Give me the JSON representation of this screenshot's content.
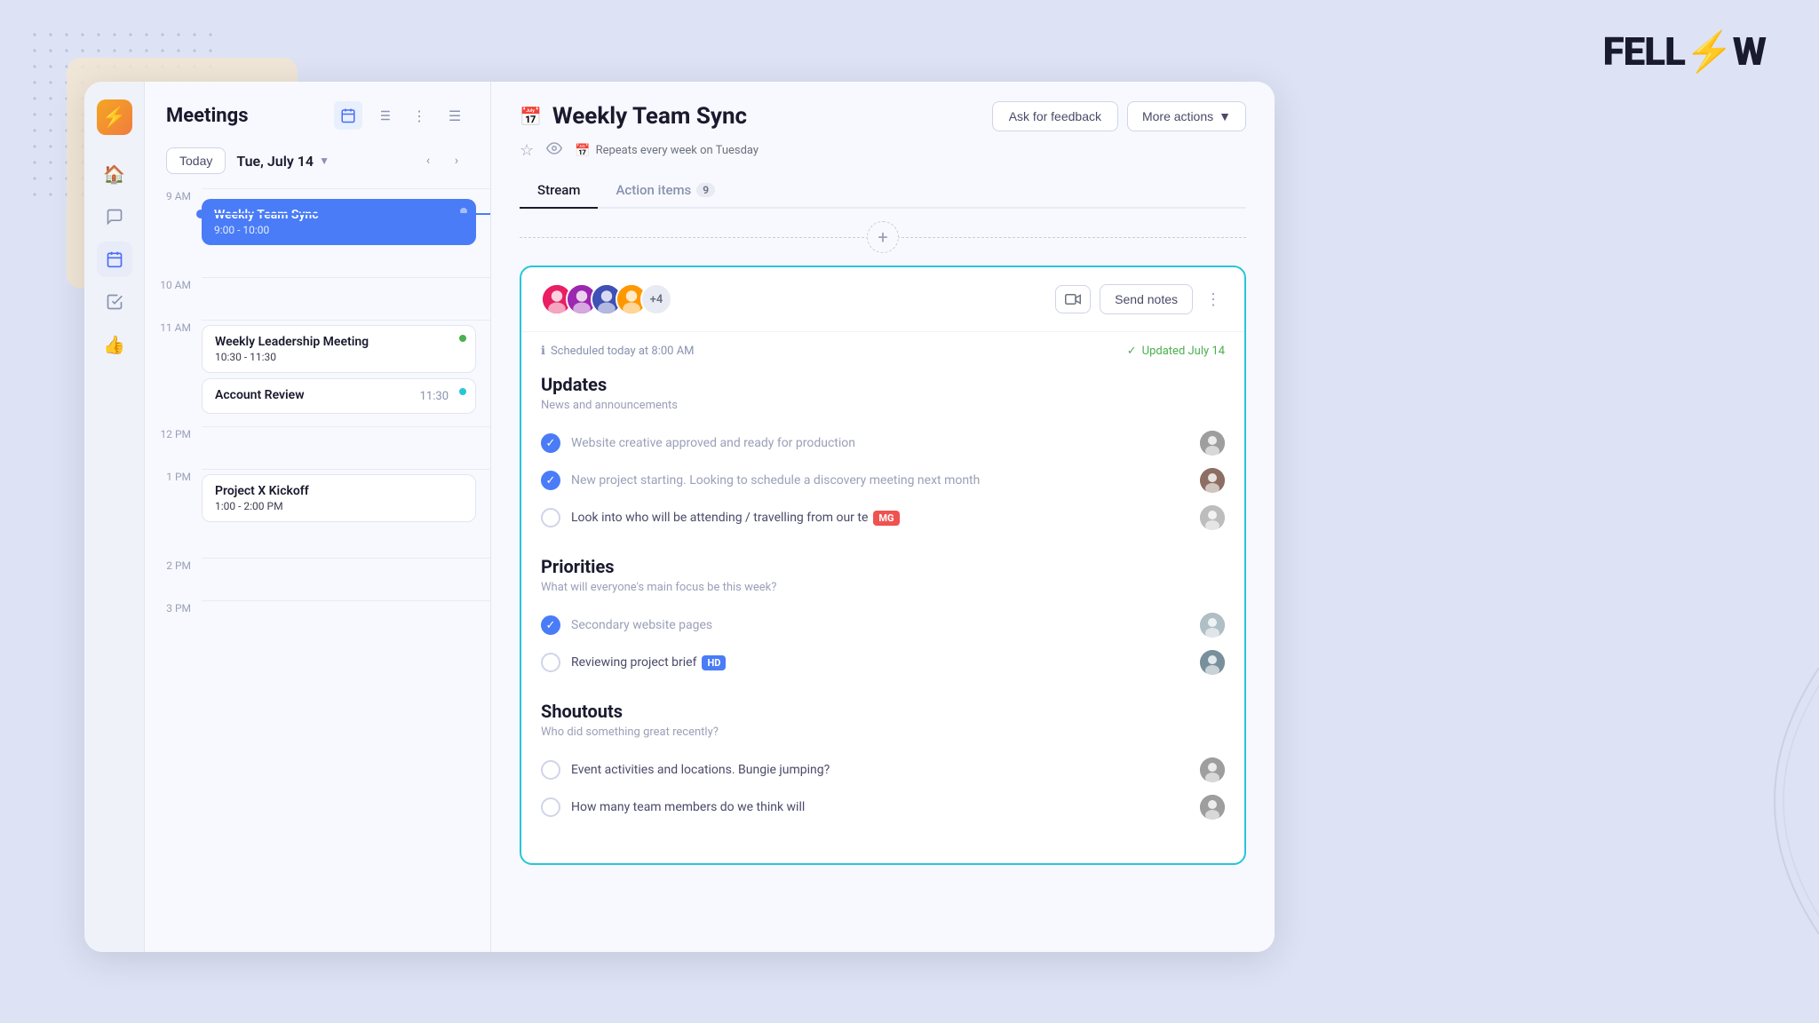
{
  "logo": {
    "text": "FELL",
    "slash": "⚡",
    "suffix": "W"
  },
  "sidebar": {
    "nav_items": [
      {
        "id": "home",
        "icon": "🏠",
        "active": false
      },
      {
        "id": "messages",
        "icon": "💬",
        "active": false
      },
      {
        "id": "calendar",
        "icon": "📅",
        "active": true
      },
      {
        "id": "tasks",
        "icon": "✓",
        "active": false
      },
      {
        "id": "thumbsup",
        "icon": "👍",
        "active": false
      }
    ]
  },
  "meetings": {
    "title": "Meetings",
    "date": "Tue, July 14",
    "today_label": "Today",
    "events": [
      {
        "id": "weekly-team-sync",
        "title": "Weekly Team Sync",
        "time": "9:00 - 10:00",
        "type": "blue",
        "dot": "blue",
        "slot": "9AM"
      },
      {
        "id": "weekly-leadership",
        "title": "Weekly Leadership Meeting",
        "time": "10:30 - 11:30",
        "type": "white",
        "dot": "green",
        "slot": "11AM"
      },
      {
        "id": "account-review",
        "title": "Account Review",
        "time_short": "11:30",
        "type": "white",
        "dot": "teal",
        "slot": "11AM"
      },
      {
        "id": "project-x",
        "title": "Project X Kickoff",
        "time": "1:00 - 2:00 PM",
        "type": "white",
        "dot": "none",
        "slot": "1PM"
      }
    ],
    "time_slots": [
      "9 AM",
      "10 AM",
      "11 AM",
      "12 PM",
      "1 PM",
      "2 PM",
      "3 PM"
    ]
  },
  "meeting_detail": {
    "title": "Weekly Team Sync",
    "repeat_info": "Repeats every week on Tuesday",
    "tabs": [
      {
        "id": "stream",
        "label": "Stream",
        "active": true,
        "badge": null
      },
      {
        "id": "action-items",
        "label": "Action items",
        "active": false,
        "badge": "9"
      }
    ],
    "buttons": {
      "ask_feedback": "Ask for feedback",
      "more_actions": "More actions"
    },
    "card": {
      "avatar_count": "+4",
      "scheduled": "Scheduled today at 8:00 AM",
      "updated": "Updated July 14",
      "send_notes": "Send notes",
      "sections": [
        {
          "id": "updates",
          "title": "Updates",
          "subtitle": "News and announcements",
          "items": [
            {
              "id": "item1",
              "text": "Website creative approved and ready for production",
              "checked": true,
              "tag": null,
              "avatar_color": "#9e9e9e"
            },
            {
              "id": "item2",
              "text": "New project starting. Looking to schedule a discovery meeting next month",
              "checked": true,
              "tag": null,
              "avatar_color": "#9e9e9e"
            },
            {
              "id": "item3",
              "text": "Look into who will be attending / travelling from our te",
              "checked": false,
              "tag": "MG",
              "tag_type": "mg",
              "avatar_color": "#9e9e9e"
            }
          ]
        },
        {
          "id": "priorities",
          "title": "Priorities",
          "subtitle": "What will everyone's main focus be this week?",
          "items": [
            {
              "id": "pri1",
              "text": "Secondary website pages",
              "checked": true,
              "tag": null,
              "avatar_color": "#b0bec5",
              "muted": true
            },
            {
              "id": "pri2",
              "text": "Reviewing project brief",
              "checked": false,
              "tag": "HD",
              "tag_type": "hd",
              "avatar_color": "#9e9e9e",
              "muted": false
            }
          ]
        },
        {
          "id": "shoutouts",
          "title": "Shoutouts",
          "subtitle": "Who did something great recently?",
          "items": [
            {
              "id": "sh1",
              "text": "Event activities and locations. Bungie jumping?",
              "checked": false,
              "circle": true,
              "avatar_color": "#9e9e9e"
            },
            {
              "id": "sh2",
              "text": "How many team members do we think will",
              "checked": false,
              "circle": true,
              "avatar_color": "#9e9e9e"
            }
          ]
        }
      ]
    }
  }
}
